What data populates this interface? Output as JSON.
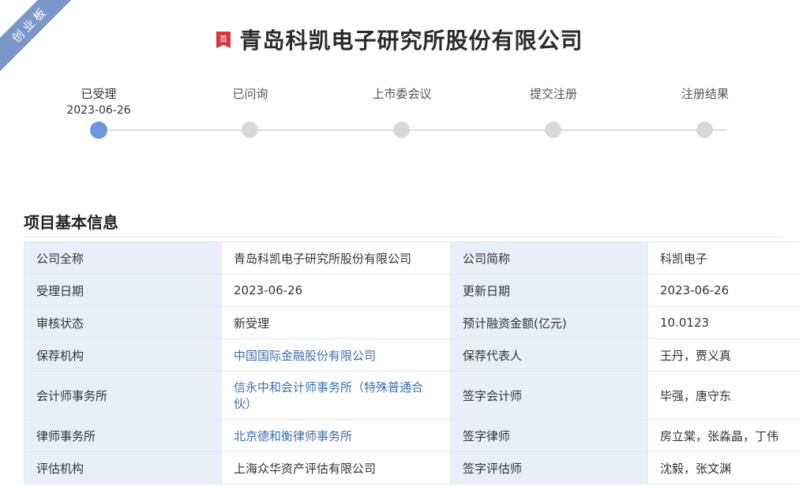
{
  "ribbon": {
    "text": "创业板"
  },
  "header": {
    "icon": "shou-badge-icon",
    "icon_text": "首",
    "title": "青岛科凯电子研究所股份有限公司",
    "icon_color": "#d9353a"
  },
  "progress": {
    "steps": [
      {
        "label": "已受理",
        "date": "2023-06-26",
        "active": true
      },
      {
        "label": "已问询",
        "date": ""
      },
      {
        "label": "上市委会议",
        "date": ""
      },
      {
        "label": "提交注册",
        "date": ""
      },
      {
        "label": "注册结果",
        "date": ""
      }
    ],
    "active_color": "#6d97d8",
    "inactive_color": "#d8d8d8"
  },
  "section": {
    "title": "项目基本信息"
  },
  "info_table": {
    "rows": [
      {
        "k1": "公司全称",
        "v1": "青岛科凯电子研究所股份有限公司",
        "k2": "公司简称",
        "v2": "科凯电子"
      },
      {
        "k1": "受理日期",
        "v1": "2023-06-26",
        "k2": "更新日期",
        "v2": "2023-06-26"
      },
      {
        "k1": "审核状态",
        "v1": "新受理",
        "k2": "预计融资金额(亿元)",
        "v2": "10.0123"
      },
      {
        "k1": "保荐机构",
        "v1": "中国国际金融股份有限公司",
        "k2": "保荐代表人",
        "v2": "王丹，贾义真"
      },
      {
        "k1": "会计师事务所",
        "v1": "信永中和会计师事务所（特殊普通合伙）",
        "k2": "签字会计师",
        "v2": "毕强，唐守东"
      },
      {
        "k1": "律师事务所",
        "v1": "北京德和衡律师事务所",
        "k2": "签字律师",
        "v2": "房立棠，张淼晶，丁伟"
      },
      {
        "k1": "评估机构",
        "v1": "上海众华资产评估有限公司",
        "k2": "签字评估师",
        "v2": "沈毅，张文渊"
      }
    ],
    "key_bg": "#e9eff8",
    "link_color": "#3a6fb0"
  }
}
